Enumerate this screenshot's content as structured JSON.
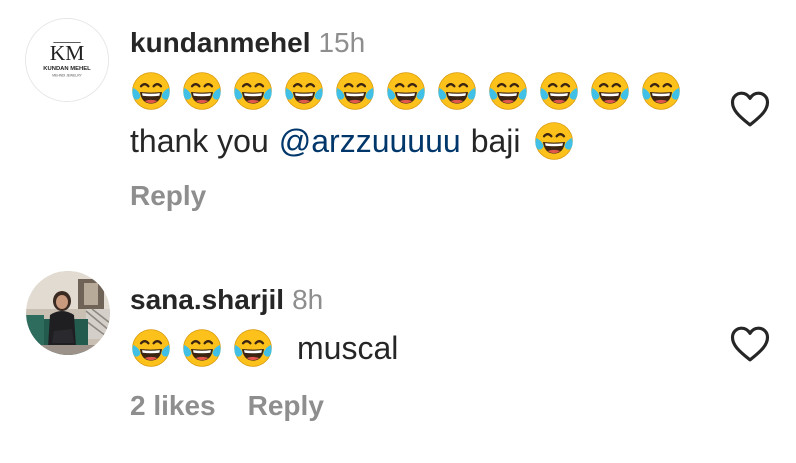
{
  "comments": [
    {
      "avatar": {
        "icon": "kundan-mehel-logo-icon",
        "monogram": "KM",
        "brand": "KUNDAN MEHEL",
        "tagline": "MEHNDI JEWELRY"
      },
      "username": "kundanmehel",
      "time": "15h",
      "emoji_row": [
        "face-with-tears-of-joy",
        "face-with-tears-of-joy",
        "face-with-tears-of-joy",
        "face-with-tears-of-joy",
        "face-with-tears-of-joy",
        "face-with-tears-of-joy",
        "face-with-tears-of-joy",
        "face-with-tears-of-joy",
        "face-with-tears-of-joy",
        "face-with-tears-of-joy",
        "face-with-tears-of-joy"
      ],
      "text_before": "thank you",
      "mention": "@arzzuuuuu",
      "text_after": "baji",
      "text_emoji": "face-with-tears-of-joy",
      "reply_label": "Reply",
      "heart_icon": "heart-outline-icon"
    },
    {
      "avatar": {
        "icon": "profile-photo"
      },
      "username": "sana.sharjil",
      "time": "8h",
      "emojis": [
        "face-with-tears-of-joy",
        "face-with-tears-of-joy",
        "face-with-tears-of-joy"
      ],
      "text": "muscal",
      "likes_label": "2 likes",
      "reply_label": "Reply",
      "heart_icon": "heart-outline-icon"
    }
  ],
  "colors": {
    "text": "#262626",
    "secondary": "#8e8e8e",
    "mention": "#00376b",
    "emoji_face": "#fcc21b",
    "emoji_tears": "#40c0e7"
  }
}
